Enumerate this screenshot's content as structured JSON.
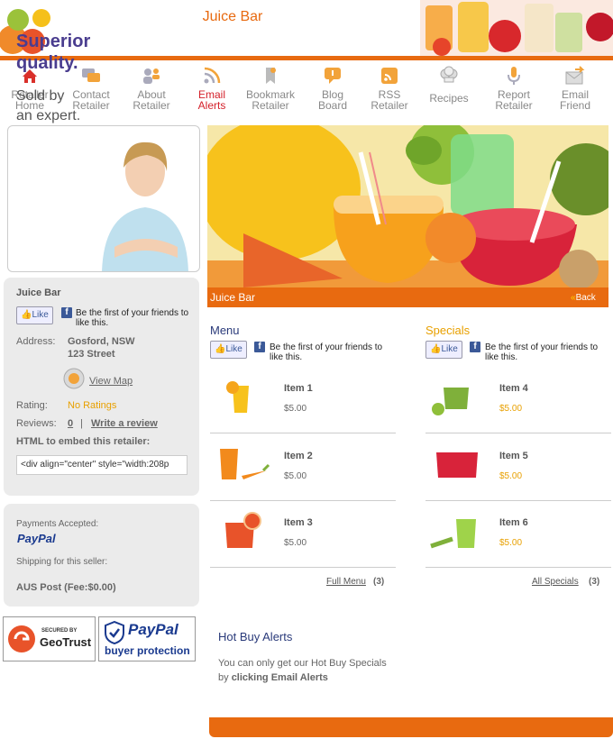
{
  "site": {
    "title": "Juice Bar"
  },
  "colors": {
    "accent": "#e86a10",
    "link": "#d4202a",
    "price": "#e8a000",
    "title_purple": "#4a3d8f"
  },
  "nav": [
    {
      "label": "Retailer Home",
      "l1": "Retailer",
      "l2": "Home",
      "icon": "home-icon"
    },
    {
      "label": "Contact Retailer",
      "l1": "Contact",
      "l2": "Retailer",
      "icon": "chat-bubbles-icon"
    },
    {
      "label": "About Retailer",
      "l1": "About",
      "l2": "Retailer",
      "icon": "people-icon"
    },
    {
      "label": "Email Alerts",
      "l1": "Email",
      "l2": "Alerts",
      "icon": "rss-icon",
      "active": true
    },
    {
      "label": "Bookmark Retailer",
      "l1": "Bookmark",
      "l2": "Retailer",
      "icon": "bookmark-icon"
    },
    {
      "label": "Blog Board",
      "l1": "Blog",
      "l2": "Board",
      "icon": "speech-bubble-icon"
    },
    {
      "label": "RSS Retailer",
      "l1": "RSS",
      "l2": "Retailer",
      "icon": "rss-feed-icon"
    },
    {
      "label": "Recipes",
      "l1": "Recipes",
      "l2": "",
      "icon": "chef-hat-icon"
    },
    {
      "label": "Report Retailer",
      "l1": "Report",
      "l2": "Retailer",
      "icon": "microphone-icon"
    },
    {
      "label": "Email Friend",
      "l1": "Email",
      "l2": "Friend",
      "icon": "envelope-arrow-icon"
    }
  ],
  "promo": {
    "headline1": "Superior",
    "headline2": "quality.",
    "sub1": "Sold by",
    "sub2": "an expert."
  },
  "retailer": {
    "name": "Juice Bar",
    "like_label": "Like",
    "fb_text1": "Be the first of your friends to",
    "fb_text2": "like this.",
    "address_label": "Address:",
    "address1": "Gosford, NSW",
    "address2": "123 Street",
    "view_map": "View Map",
    "rating_label": "Rating:",
    "rating_value": "No Ratings",
    "reviews_label": "Reviews:",
    "reviews_count": "0",
    "reviews_sep": "|",
    "write_review": "Write a review",
    "embed_label": "HTML to embed this retailer:",
    "embed_value": "<div align=\"center\" style=\"width:208p"
  },
  "payment": {
    "accepted_label": "Payments Accepted:",
    "paypal": "PayPal",
    "shipping_label": "Shipping for this seller:",
    "shipping_value": "AUS Post (Fee:$0.00)"
  },
  "badges": {
    "geotrust_top": "SECURED BY",
    "geotrust_name": "GeoTrust",
    "paypal_name": "PayPal",
    "paypal_sub": "buyer protection"
  },
  "banner": {
    "caption": "Juice Bar",
    "back": "Back"
  },
  "menu": {
    "title": "Menu",
    "items": [
      {
        "name": "Item 1",
        "price": "$5.00"
      },
      {
        "name": "Item 2",
        "price": "$5.00"
      },
      {
        "name": "Item 3",
        "price": "$5.00"
      }
    ],
    "footer_link": "Full Menu",
    "footer_count": "(3)"
  },
  "specials": {
    "title": "Specials",
    "items": [
      {
        "name": "Item 4",
        "price": "$5.00"
      },
      {
        "name": "Item 5",
        "price": "$5.00"
      },
      {
        "name": "Item 6",
        "price": "$5.00"
      }
    ],
    "footer_link": "All Specials",
    "footer_count": "(3)"
  },
  "hot_buy": {
    "title": "Hot Buy Alerts",
    "text1": "You can only get our Hot Buy Specials",
    "text2_prefix": "by ",
    "text2_bold": "clicking Email Alerts"
  }
}
